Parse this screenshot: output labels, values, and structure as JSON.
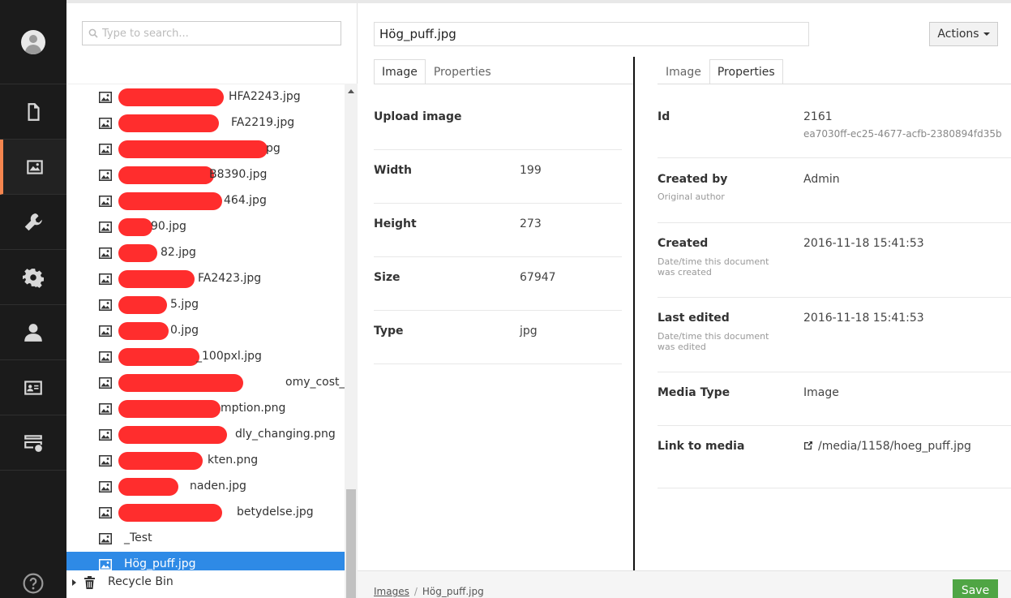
{
  "search": {
    "placeholder": "Type to search..."
  },
  "sections": [
    "content-icon",
    "media-icon",
    "settings-wrench-icon",
    "developer-gear-icon",
    "users-icon",
    "members-icon",
    "forms-icon"
  ],
  "tree": {
    "items": [
      {
        "label": "HFA2243.jpg",
        "redact_w": 130,
        "label_left": 200
      },
      {
        "label": "FA2219.jpg",
        "redact_w": 124,
        "label_left": 203
      },
      {
        "label": "pg",
        "redact_w": 184,
        "label_left": 246
      },
      {
        "label": "B8390.jpg",
        "redact_w": 118,
        "label_left": 176
      },
      {
        "label": "464.jpg",
        "redact_w": 128,
        "label_left": 194
      },
      {
        "label": "90.jpg",
        "redact_w": 42,
        "label_left": 104
      },
      {
        "label": "82.jpg",
        "redact_w": 48,
        "label_left": 116
      },
      {
        "label": "FA2423.jpg",
        "redact_w": 94,
        "label_left": 162
      },
      {
        "label": "5.jpg",
        "redact_w": 60,
        "label_left": 128
      },
      {
        "label": "0.jpg",
        "redact_w": 62,
        "label_left": 128
      },
      {
        "label": "_100pxl.jpg",
        "redact_w": 100,
        "label_left": 160
      },
      {
        "label": "omy_cost_of_reg",
        "redact_w": 154,
        "label_left": 270
      },
      {
        "label": "mption.png",
        "redact_w": 126,
        "label_left": 190
      },
      {
        "label": "dly_changing.png",
        "redact_w": 134,
        "label_left": 208
      },
      {
        "label": "kten.png",
        "redact_w": 104,
        "label_left": 174
      },
      {
        "label": "naden.jpg",
        "redact_w": 74,
        "label_left": 152
      },
      {
        "label": "betydelse.jpg",
        "redact_w": 128,
        "label_left": 210
      },
      {
        "label": "_Test",
        "redact_w": 0,
        "label_left": 71
      },
      {
        "label": "Hög_puff.jpg",
        "redact_w": 0,
        "label_left": 71,
        "selected": true
      }
    ],
    "recycle_bin": "Recycle Bin"
  },
  "editor": {
    "name": "Hög_puff.jpg",
    "actions_label": "Actions",
    "left_tabs": {
      "image": "Image",
      "properties": "Properties"
    },
    "right_tabs": {
      "image": "Image",
      "properties": "Properties"
    },
    "image_props": [
      {
        "key": "Upload image",
        "value": ""
      },
      {
        "key": "Width",
        "value": "199"
      },
      {
        "key": "Height",
        "value": "273"
      },
      {
        "key": "Size",
        "value": "67947"
      },
      {
        "key": "Type",
        "value": "jpg"
      }
    ],
    "properties": {
      "id_label": "Id",
      "id_value": "2161",
      "guid": "ea7030ff-ec25-4677-acfb-2380894fd35b",
      "created_by_label": "Created by",
      "created_by_sub": "Original author",
      "created_by_value": "Admin",
      "created_label": "Created",
      "created_sub": "Date/time this document was created",
      "created_value": "2016-11-18 15:41:53",
      "edited_label": "Last edited",
      "edited_sub": "Date/time this document was edited",
      "edited_value": "2016-11-18 15:41:53",
      "media_type_label": "Media Type",
      "media_type_value": "Image",
      "link_label": "Link to media",
      "link_value": "/media/1158/hoeg_puff.jpg"
    },
    "breadcrumb": {
      "root": "Images",
      "current": "Hög_puff.jpg"
    },
    "save_label": "Save"
  },
  "colors": {
    "accent": "#f5864f",
    "selected": "#2e8ae6",
    "save": "#4fa544",
    "redaction": "#ff2d2d"
  }
}
